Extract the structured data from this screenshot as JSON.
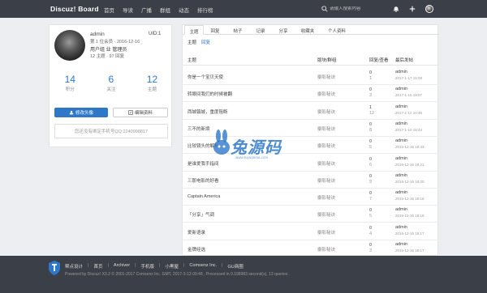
{
  "header": {
    "brand": "Discuz! Board",
    "nav": [
      "首页",
      "导读",
      "广播",
      "群组",
      "动态",
      "排行榜"
    ],
    "search_placeholder": "请输入搜索内容"
  },
  "profile": {
    "username": "admin",
    "uid": "UID:1",
    "line1": "第 1 位会员 · 2016-12-16",
    "line2": "用户组 业 管理员",
    "line3": "12 主题 · 97 回复",
    "stats": [
      {
        "num": "14",
        "label": "积分"
      },
      {
        "num": "6",
        "label": "关注"
      },
      {
        "num": "12",
        "label": "主题"
      }
    ],
    "btn_avatar": "修改头像",
    "btn_profile": "编辑资料",
    "note": "您还没有绑定手机号QQ:2240998817"
  },
  "content": {
    "tabs": [
      "主题",
      "回复",
      "帖子",
      "记录",
      "分享",
      "收藏夹",
      "个人资料"
    ],
    "subtabs": [
      "主题",
      "回复"
    ],
    "columns": {
      "title": "主题",
      "forum": "版块/群组",
      "replies": "回复/查看",
      "last": "最后发帖"
    },
    "rows": [
      {
        "title": "你是一个宝贝天使",
        "forum": "摄影秘诀",
        "rep": "0",
        "view": "1",
        "user": "admin",
        "date": "2017-1-17 15:08"
      },
      {
        "title": "转眼间我们的时候被翻",
        "forum": "摄影秘诀",
        "rep": "0",
        "view": "3",
        "user": "admin",
        "date": "2017-1-15 19:07"
      },
      {
        "title": "西城镇城，重度阻断",
        "forum": "摄影秘诀",
        "rep": "1",
        "view": "12",
        "user": "admin",
        "date": "2017-1-12 10:46"
      },
      {
        "title": "三不的新境",
        "forum": "摄影秘诀",
        "rep": "0",
        "view": "8",
        "user": "admin",
        "date": "2017-1-10 18:44"
      },
      {
        "title": "比较镜头的解析",
        "forum": "摄影秘诀",
        "rep": "0",
        "view": "5",
        "user": "admin",
        "date": "2016-12-16 18:43"
      },
      {
        "title": "是谁爱我手指间",
        "forum": "摄影秘诀",
        "rep": "0",
        "view": "6",
        "user": "admin",
        "date": "2016-12-16 18:21"
      },
      {
        "title": "三那电影的好看",
        "forum": "摄影秘诀",
        "rep": "0",
        "view": "9",
        "user": "admin",
        "date": "2016-12-16 18:20"
      },
      {
        "title": "Captain America",
        "forum": "摄影秘诀",
        "rep": "0",
        "view": "7",
        "user": "admin",
        "date": "2016-12-16 18:18"
      },
      {
        "title": "「分享」气调",
        "forum": "摄影秘诀",
        "rep": "0",
        "view": "5",
        "user": "admin",
        "date": "2016-12-16 18:18"
      },
      {
        "title": "爱新语录",
        "forum": "摄影秘诀",
        "rep": "0",
        "view": "4",
        "user": "admin",
        "date": "2016-12-16 18:17"
      },
      {
        "title": "金牌经选",
        "forum": "摄影秘诀",
        "rep": "0",
        "view": "3",
        "user": "admin",
        "date": "2016-12-16 18:17"
      }
    ]
  },
  "watermark": {
    "text": "兔源码",
    "url": "www.tuyuanma.com"
  },
  "footer": {
    "links": [
      "帮点设计",
      "首页",
      "Archiver",
      "手机版",
      "小黑屋",
      "Comsenz Inc.",
      "GU商圈"
    ],
    "copyright": "Powered by Discuz! X3.2 © 2001-2017 Comsenz Inc. GMT, 2017-3-13 09:48 , Processed in 0.198983 second(s), 13 queries ."
  }
}
